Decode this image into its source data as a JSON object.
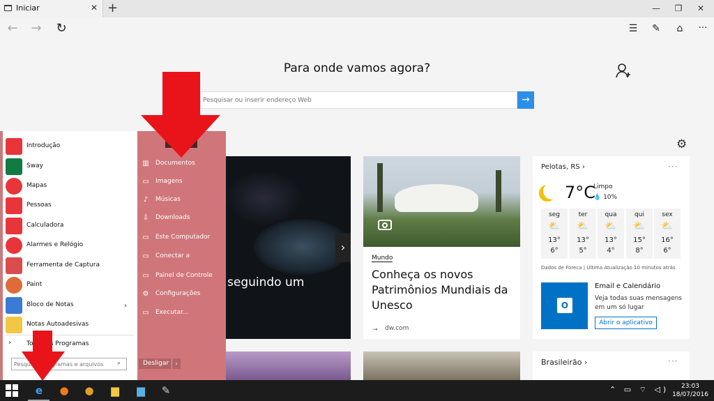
{
  "browser": {
    "tab_title": "Iniciar",
    "tab_close": "✕",
    "new_tab": "+",
    "window_min": "—",
    "window_restore": "❐",
    "window_close": "✕",
    "back": "←",
    "forward": "→",
    "refresh": "↻",
    "hub": "☰",
    "notes": "✎",
    "share": "⌂",
    "more": "···"
  },
  "page": {
    "heading": "Para onde vamos agora?",
    "search_placeholder": "Pesquisar ou inserir endereço Web",
    "search_go": "→",
    "settings_icon": "⚙"
  },
  "news": {
    "dark_card_text": "seguindo um",
    "dark_card_next": "›",
    "unesco": {
      "category": "Mundo",
      "title": "Conheça os novos Patrimônios Mundiais da Unesco",
      "source_icon": "⊸",
      "source": "dw.com"
    }
  },
  "weather": {
    "city": "Pelotas, RS  ›",
    "more": "···",
    "temp": "7°C",
    "condition": "Limpo",
    "rain": "💧 10%",
    "days": [
      {
        "name": "seg",
        "icon": "⛅",
        "high": "13°",
        "low": "6°"
      },
      {
        "name": "ter",
        "icon": "⛅",
        "high": "13°",
        "low": "5°"
      },
      {
        "name": "qua",
        "icon": "⛅",
        "high": "13°",
        "low": "4°"
      },
      {
        "name": "qui",
        "icon": "⛅",
        "high": "15°",
        "low": "8°"
      },
      {
        "name": "sex",
        "icon": "⛅",
        "high": "16°",
        "low": "6°"
      }
    ],
    "credit": "Dados de Foreca | Última Atualização 10 minutos atrás"
  },
  "mail": {
    "logo": "O",
    "title": "Email e Calendário",
    "desc": "Veja todas suas mensagens em um só lugar",
    "button": "Abrir o aplicativo"
  },
  "bottom": {
    "section": "Brasileirão  ›",
    "more": "···"
  },
  "start_menu": {
    "apps": [
      {
        "label": "Introdução",
        "color": "#e8353a"
      },
      {
        "label": "Sway",
        "color": "#107c41"
      },
      {
        "label": "Mapas",
        "color": "#e8353a"
      },
      {
        "label": "Pessoas",
        "color": "#e8353a"
      },
      {
        "label": "Calculadora",
        "color": "#e8353a"
      },
      {
        "label": "Alarmes e Relógio",
        "color": "#e8353a"
      },
      {
        "label": "Ferramenta de Captura",
        "color": "#d94d4d"
      },
      {
        "label": "Paint",
        "color": "#e06a3a"
      },
      {
        "label": "Bloco de Notas",
        "color": "#3a7bd5"
      },
      {
        "label": "Notas Autoadesivas",
        "color": "#f2c744"
      }
    ],
    "notepad_chevron": "›",
    "all_programs_arrow": "›",
    "all_programs": "Todos os Programas",
    "search_placeholder": "Pesquisar programas e arquivos",
    "search_icon": "⌕",
    "links": [
      {
        "icon": "▥",
        "label": "Documentos"
      },
      {
        "icon": "▭",
        "label": "Imagens"
      },
      {
        "icon": "♪",
        "label": "Músicas"
      },
      {
        "icon": "⇩",
        "label": "Downloads"
      },
      {
        "icon": "▭",
        "label": "Este Computador"
      },
      {
        "icon": "▭",
        "label": "Conectar a"
      },
      {
        "icon": "▭",
        "label": "Painel de Controle"
      },
      {
        "icon": "⚙",
        "label": "Configurações"
      },
      {
        "icon": "▭",
        "label": "Executar..."
      }
    ],
    "shutdown": "Desligar",
    "shutdown_arrow": "›"
  },
  "taskbar": {
    "apps": [
      {
        "icon": "e",
        "color": "#3aa0f0"
      },
      {
        "icon": "●",
        "color": "#f07a1a"
      },
      {
        "icon": "●",
        "color": "#e0a020"
      },
      {
        "icon": "▆",
        "color": "#f2c744"
      },
      {
        "icon": "▆",
        "color": "#5ab0e0"
      },
      {
        "icon": "✎",
        "color": "#d0d0d0"
      }
    ],
    "tray": "⌃ ▭ ⌔ ◁)",
    "time": "23:03",
    "date": "18/07/2016"
  },
  "colors": {
    "accent": "#2b8fea",
    "start_panel": "#c85a5f",
    "annotation_arrow": "#e8141a",
    "mail_tile": "#0072c6"
  }
}
